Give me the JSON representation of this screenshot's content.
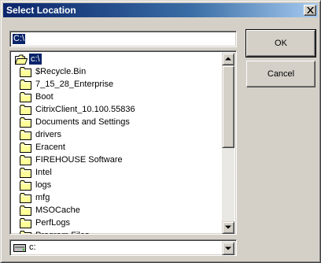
{
  "window": {
    "title": "Select Location",
    "close_icon": "close-icon"
  },
  "path_input": {
    "value": "C:\\"
  },
  "buttons": {
    "ok_label": "OK",
    "cancel_label": "Cancel"
  },
  "folder_list": {
    "items": [
      {
        "label": "c:\\",
        "icon": "open-folder-icon",
        "selected": true
      },
      {
        "label": "$Recycle.Bin",
        "icon": "folder-icon"
      },
      {
        "label": "7_15_28_Enterprise",
        "icon": "folder-icon"
      },
      {
        "label": "Boot",
        "icon": "folder-icon"
      },
      {
        "label": "CitrixClient_10.100.55836",
        "icon": "folder-icon"
      },
      {
        "label": "Documents and Settings",
        "icon": "folder-icon"
      },
      {
        "label": "drivers",
        "icon": "folder-icon"
      },
      {
        "label": "Eracent",
        "icon": "folder-icon"
      },
      {
        "label": "FIREHOUSE Software",
        "icon": "folder-icon"
      },
      {
        "label": "Intel",
        "icon": "folder-icon"
      },
      {
        "label": "logs",
        "icon": "folder-icon"
      },
      {
        "label": "mfg",
        "icon": "folder-icon"
      },
      {
        "label": "MSOCache",
        "icon": "folder-icon"
      },
      {
        "label": "PerfLogs",
        "icon": "folder-icon"
      },
      {
        "label": "Program Files",
        "icon": "folder-icon"
      }
    ]
  },
  "drive_select": {
    "value": "c:",
    "icon": "hard-drive-icon"
  },
  "colors": {
    "dialog_face": "#d4d0c8",
    "title_bar": "#0a246a",
    "selection": "#0a246a",
    "folder_yellow": "#ffff99"
  }
}
